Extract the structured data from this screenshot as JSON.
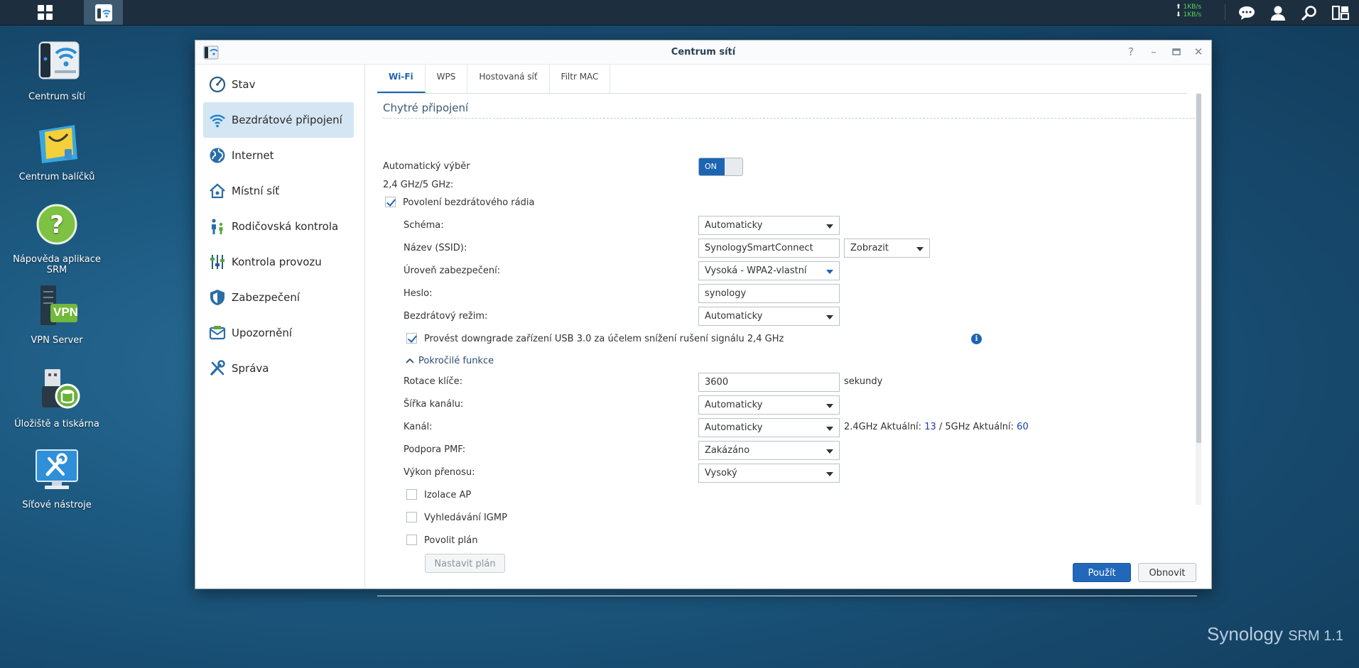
{
  "taskbar": {
    "speed_up": "1KB/s",
    "speed_down": "1KB/s",
    "icons": [
      "main-menu-icon",
      "network-center-icon",
      "chat-icon",
      "user-icon",
      "search-icon",
      "widgets-icon"
    ]
  },
  "desktop": {
    "icons": [
      {
        "label": "Centrum sítí",
        "icon": "network-center-icon"
      },
      {
        "label": "Centrum balíčků",
        "icon": "package-center-icon"
      },
      {
        "label": "Nápověda aplikace SRM",
        "icon": "help-icon"
      },
      {
        "label": "VPN Server",
        "icon": "vpn-server-icon"
      },
      {
        "label": "Úložiště a tiskárna",
        "icon": "storage-printer-icon"
      },
      {
        "label": "Síťové nástroje",
        "icon": "network-tools-icon"
      }
    ],
    "vpn_badge": "VPN",
    "brand": "Synology",
    "brand_product": "SRM 1.1"
  },
  "window": {
    "title": "Centrum sítí",
    "sidebar": [
      {
        "label": "Stav",
        "icon": "gauge-icon"
      },
      {
        "label": "Bezdrátové připojení",
        "icon": "wifi-icon"
      },
      {
        "label": "Internet",
        "icon": "globe-icon"
      },
      {
        "label": "Místní síť",
        "icon": "home-icon"
      },
      {
        "label": "Rodičovská kontrola",
        "icon": "family-icon"
      },
      {
        "label": "Kontrola provozu",
        "icon": "sliders-icon"
      },
      {
        "label": "Zabezpečení",
        "icon": "shield-icon"
      },
      {
        "label": "Upozornění",
        "icon": "notification-icon"
      },
      {
        "label": "Správa",
        "icon": "tools-icon"
      }
    ],
    "tabs": [
      "Wi-Fi",
      "WPS",
      "Hostovaná síť",
      "Filtr MAC"
    ],
    "section_title": "Chytré připojení",
    "form": {
      "auto_select_label": "Automatický výběr",
      "auto_select_sub": "2,4 GHz/5 GHz:",
      "toggle_state": "ON",
      "enable_radio_label": "Povolení bezdrátového rádia",
      "schema_label": "Schéma:",
      "schema_value": "Automaticky",
      "ssid_label": "Název (SSID):",
      "ssid_value": "SynologySmartConnect",
      "ssid_display_value": "Zobrazit",
      "security_label": "Úroveň zabezpečení:",
      "security_value": "Vysoká - WPA2-vlastní",
      "password_label": "Heslo:",
      "password_value": "synology",
      "wireless_mode_label": "Bezdrátový režim:",
      "wireless_mode_value": "Automaticky",
      "usb_downgrade_label": "Provést downgrade zařízení USB 3.0 za účelem snížení rušení signálu 2,4 GHz",
      "advanced_label": "Pokročilé funkce",
      "key_rotation_label": "Rotace klíče:",
      "key_rotation_value": "3600",
      "key_rotation_unit": "sekundy",
      "channel_width_label": "Šířka kanálu:",
      "channel_width_value": "Automaticky",
      "channel_label": "Kanál:",
      "channel_value": "Automaticky",
      "channel_info_prefix": "2.4GHz Aktuální:",
      "channel_24": "13",
      "channel_info_mid": "/ 5GHz Aktuální:",
      "channel_5": "60",
      "pmf_label": "Podpora PMF:",
      "pmf_value": "Zakázáno",
      "tx_power_label": "Výkon přenosu:",
      "tx_power_value": "Vysoký",
      "ap_isolation_label": "Izolace AP",
      "igmp_label": "Vyhledávání IGMP",
      "schedule_label": "Povolit plán",
      "schedule_button": "Nastavit plán"
    },
    "footer": {
      "apply": "Použít",
      "refresh": "Obnovit"
    }
  }
}
